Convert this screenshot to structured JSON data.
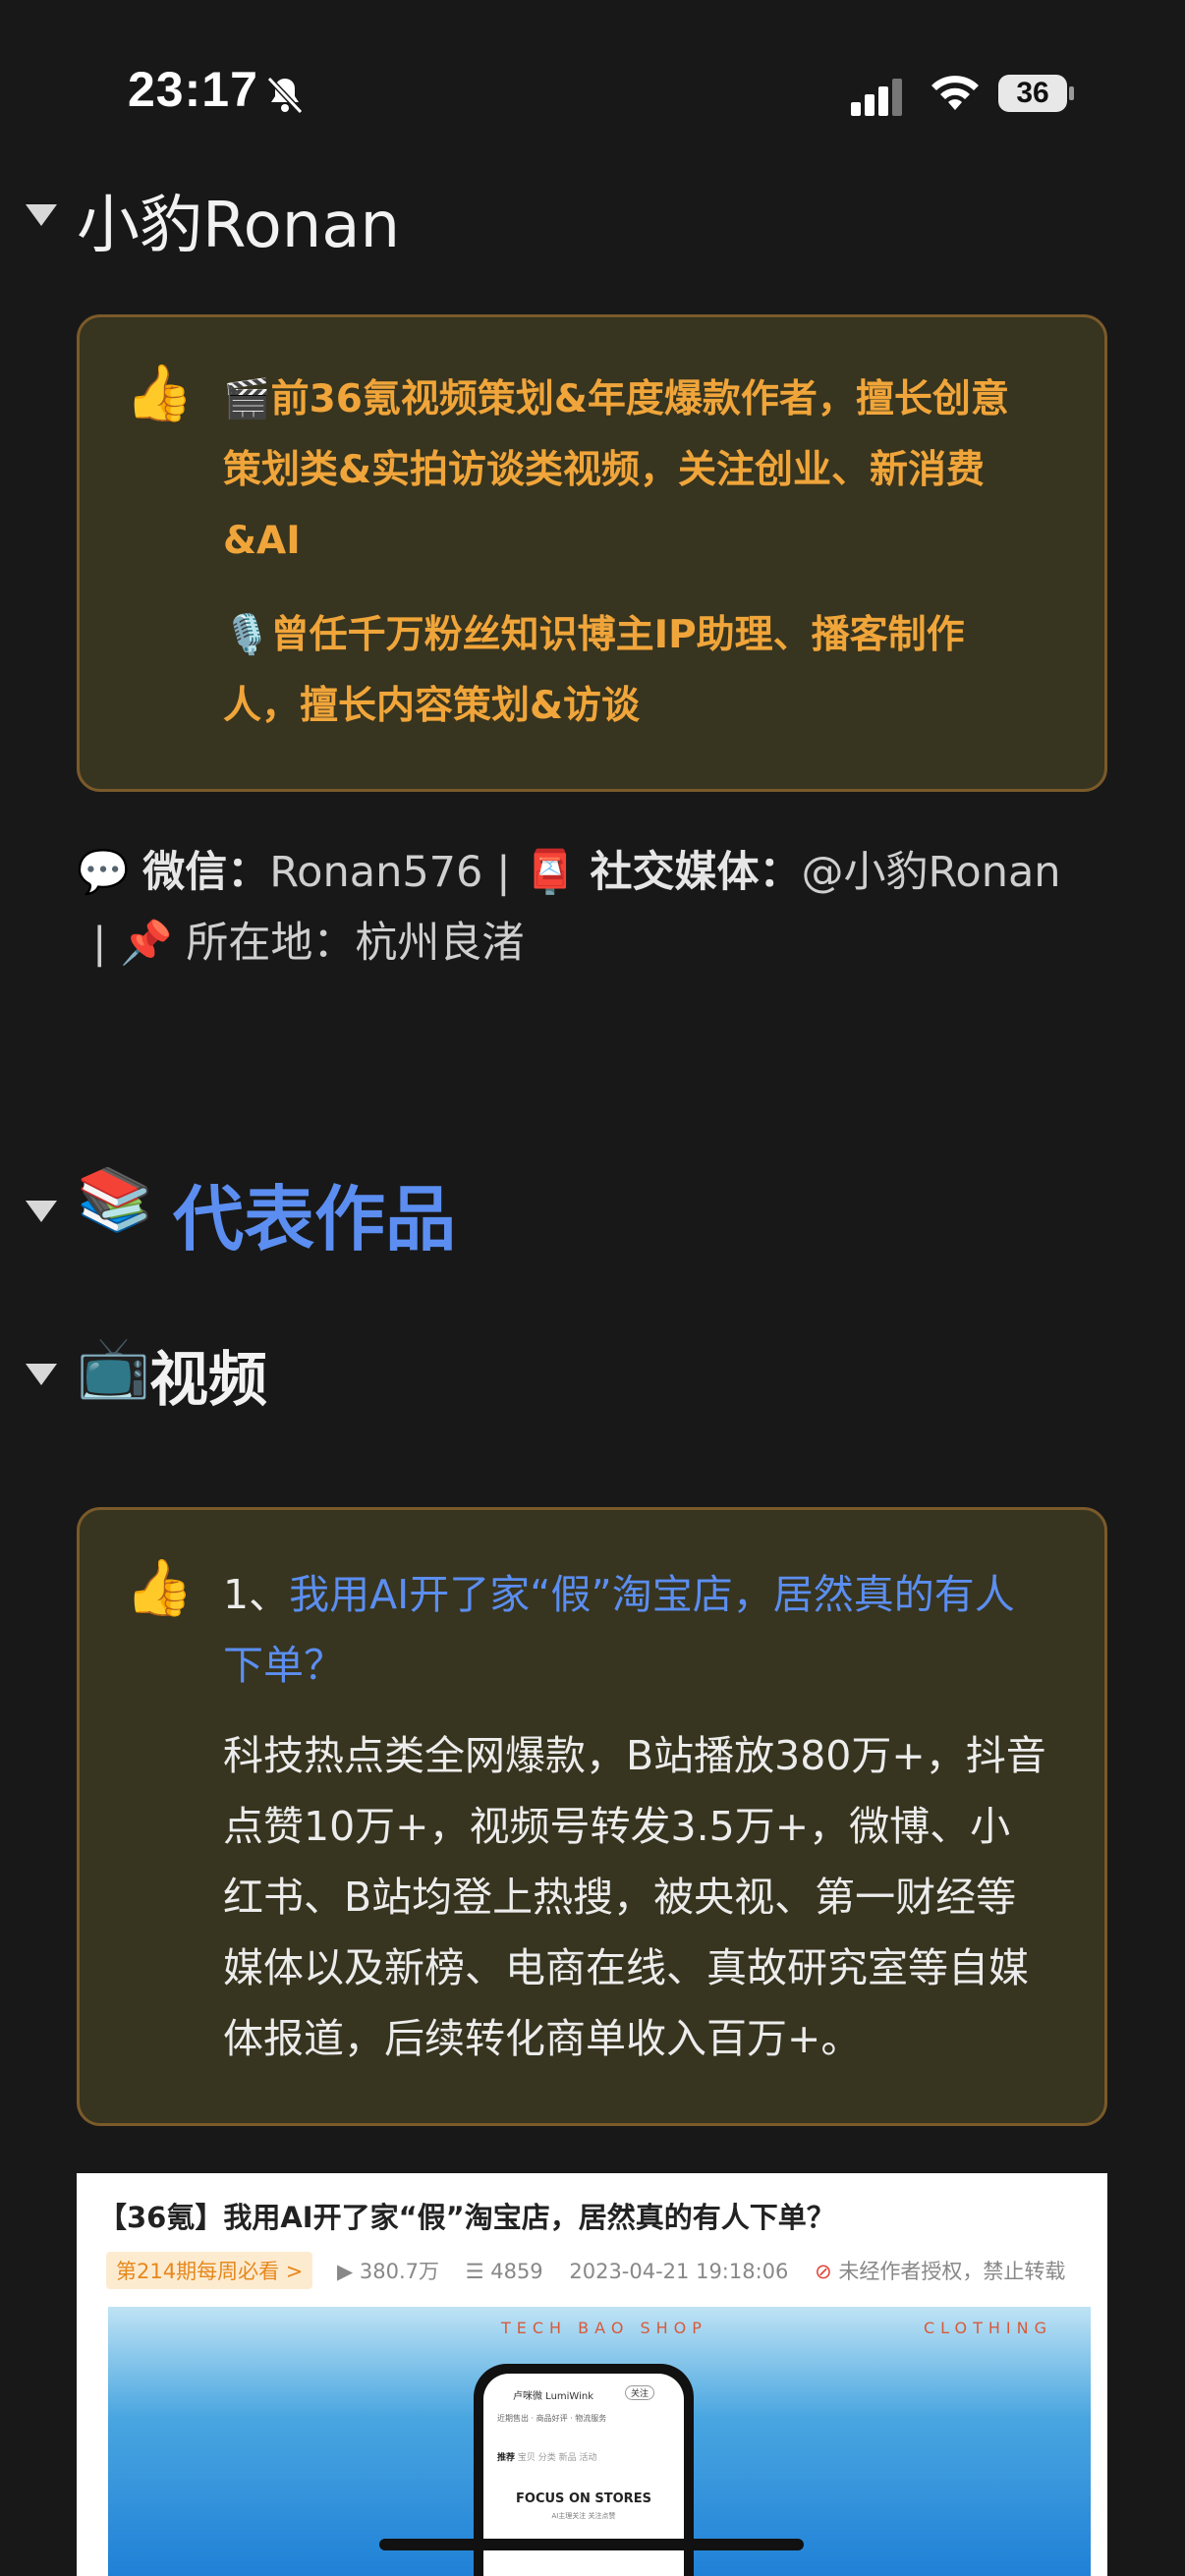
{
  "status_bar": {
    "time": "23:17",
    "battery": "36"
  },
  "profile": {
    "name": "小豹Ronan",
    "bio_line1": "前36氪视频策划&年度爆款作者，擅长创意策划类&实拍访谈类视频，关注创业、新消费&AI",
    "bio_line2": "曾任千万粉丝知识博主IP助理、播客制作人，擅长内容策划&访谈",
    "wechat_label": "微信：",
    "wechat_value": "Ronan576 |",
    "social_label": "社交媒体：",
    "social_value": "@小豹Ronan",
    "location_sep": "|",
    "location": "所在地：杭州良渚"
  },
  "works": {
    "heading": "代表作品",
    "video_heading": "视频",
    "item1": {
      "number": "1、",
      "title": "我用AI开了家“假”淘宝店，居然真的有人下单？",
      "description": "科技热点类全网爆款，B站播放380万+，抖音点赞10万+，视频号转发3.5万+，微博、小红书、B站均登上热搜，被央视、第一财经等媒体以及新榜、电商在线、真故研究室等自媒体报道，后续转化商单收入百万+。"
    }
  },
  "video_card": {
    "title": "【36氪】我用AI开了家“假”淘宝店，居然真的有人下单？",
    "tag": "第214期每周必看 >",
    "views": "380.7万",
    "comments": "4859",
    "date": "2023-04-21 19:18:06",
    "notice": "未经作者授权，禁止转载",
    "thumb_banner": "TECH  BAO  SHOP",
    "thumb_banner_right": "CLOTHING",
    "phone_brand": "卢咪微 LumiWink",
    "phone_follow": "关注",
    "phone_stats": "近期售出 · 商品好评 · 物流服务",
    "phone_tabs_active": "推荐",
    "phone_tabs": "宝贝  分类  新品  活动",
    "phone_focus": "FOCUS ON STORES",
    "phone_focus_sub": "AI主理关注 关注点赞"
  }
}
